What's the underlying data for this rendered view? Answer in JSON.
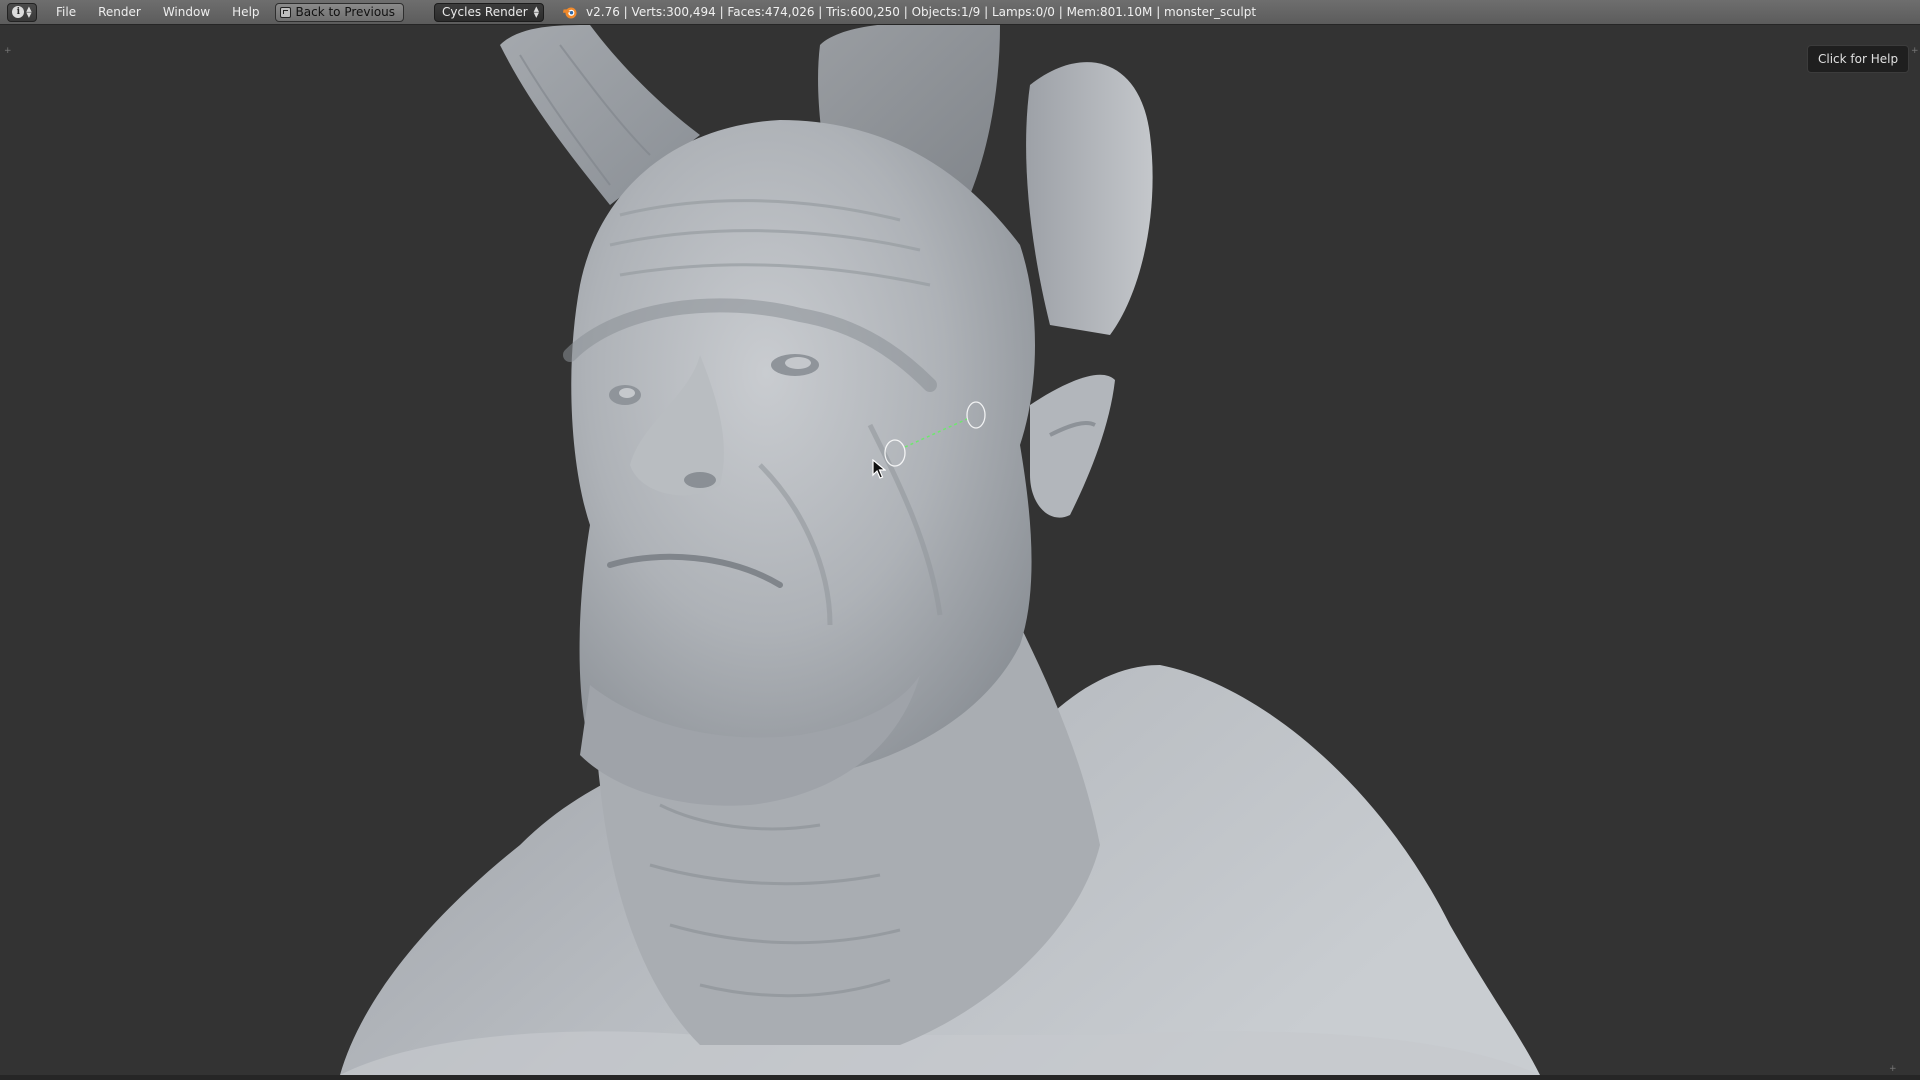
{
  "header": {
    "menus": [
      "File",
      "Render",
      "Window",
      "Help"
    ],
    "back_label": "Back to Previous",
    "engine": "Cycles Render",
    "stats": "v2.76 | Verts:300,494 | Faces:474,026 | Tris:600,250 | Objects:1/9 | Lamps:0/0 | Mem:801.10M | monster_sculpt"
  },
  "icons": {
    "editor_type": "info-icon",
    "back": "back-screen-icon",
    "engine_arrows": "up-down-arrows-icon",
    "logo": "blender-logo-icon",
    "cursor": "mouse-pointer-icon"
  },
  "viewport": {
    "help_label": "Click for Help",
    "background_color": "#333333",
    "stroke_guide_color": "#6ee86e"
  }
}
